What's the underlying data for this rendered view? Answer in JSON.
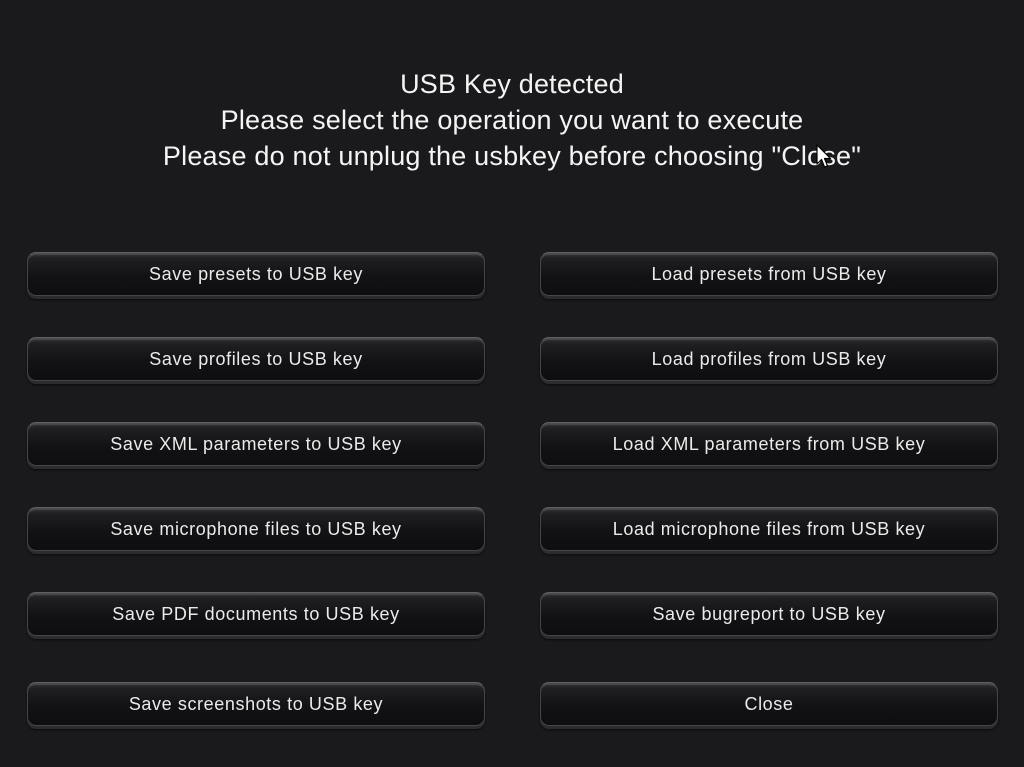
{
  "header": {
    "line1": "USB Key detected",
    "line2": "Please select the operation you want to execute",
    "line3": "Please do not unplug the usbkey before choosing \"Close\""
  },
  "buttons": {
    "save_presets": "Save presets to USB key",
    "load_presets": "Load presets from USB key",
    "save_profiles": "Save profiles to USB key",
    "load_profiles": "Load profiles from USB key",
    "save_xml": "Save XML parameters to USB key",
    "load_xml": "Load XML parameters from USB key",
    "save_microphone": "Save microphone files to USB key",
    "load_microphone": "Load microphone files from USB key",
    "save_pdf": "Save PDF documents to USB key",
    "save_bugreport": "Save bugreport to USB key",
    "save_screenshots": "Save screenshots to USB key",
    "close": "Close"
  },
  "icons": {
    "cursor": "mouse-pointer-icon"
  },
  "colors": {
    "background": "#1a1a1c",
    "text": "#ffffff",
    "button_face": "#121214",
    "button_border": "#46464a"
  }
}
